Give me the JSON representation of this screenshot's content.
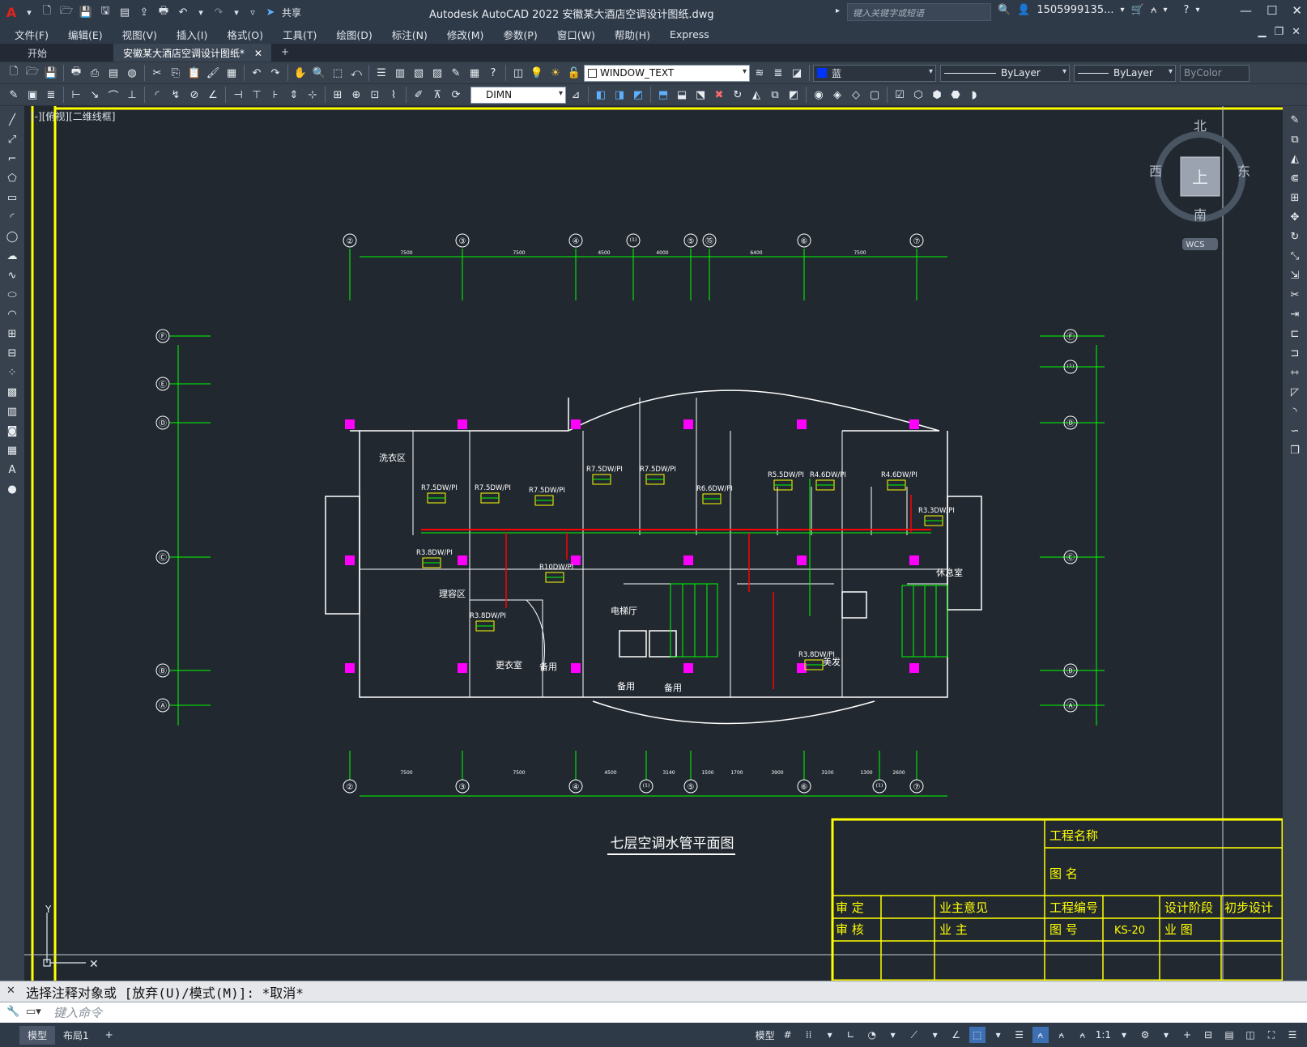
{
  "titlebar": {
    "app_title": "Autodesk AutoCAD 2022    安徽某大酒店空调设计图纸.dwg",
    "share_label": "共享",
    "search_placeholder": "键入关键字或短语",
    "user": "1505999135...",
    "menu_a": "A"
  },
  "menus": [
    "文件(F)",
    "编辑(E)",
    "视图(V)",
    "插入(I)",
    "格式(O)",
    "工具(T)",
    "绘图(D)",
    "标注(N)",
    "修改(M)",
    "参数(P)",
    "窗口(W)",
    "帮助(H)",
    "Express"
  ],
  "doc_tabs": {
    "start": "开始",
    "active": "安徽某大酒店空调设计图纸*",
    "add": "+"
  },
  "toolbar": {
    "layer_name": "WINDOW_TEXT",
    "color_name": "蓝",
    "linetype": "ByLayer",
    "lineweight": "ByLayer",
    "plotstyle": "ByColor",
    "dimstyle": "DIMN"
  },
  "viewport_label": "[-][俯视][二维线框]",
  "viewcube": {
    "north": "北",
    "south": "南",
    "east": "东",
    "west": "西",
    "face": "上",
    "wcs": "WCS"
  },
  "drawing": {
    "title": "七层空调水管平面图",
    "top_axes": [
      "②",
      "③",
      "④",
      "⁽¹⁾",
      "⑤",
      "⑮",
      "⑥",
      "⑦"
    ],
    "bottom_axes": [
      "②",
      "③",
      "④",
      "⁽¹⁾",
      "⑤",
      "⑥",
      "⁽¹⁾",
      "⑦"
    ],
    "left_axes": [
      "Ⓕ",
      "Ⓔ",
      "Ⓓ",
      "Ⓒ",
      "Ⓑ",
      "Ⓐ"
    ],
    "right_axes": [
      "Ⓕ",
      "⁽¹⁾",
      "Ⓓ",
      "Ⓒ",
      "Ⓑ",
      "Ⓐ"
    ],
    "top_dims": [
      "7500",
      "7500",
      "4500",
      "4000",
      "6400",
      "7500"
    ],
    "bottom_dims": [
      "7500",
      "7500",
      "4500",
      "3140",
      "1500",
      "1700",
      "3900",
      "3100",
      "1300",
      "2600"
    ],
    "rooms": [
      "洗衣区",
      "理容区",
      "更衣室",
      "备用",
      "电梯厅",
      "备用",
      "备用",
      "美发",
      "休息室"
    ],
    "units": [
      "R7.5DW/PI",
      "R7.5DW/PI",
      "R7.5DW/PI",
      "R7.5DW/PI",
      "R7.5DW/PI",
      "R6.6DW/PI",
      "R5.5DW/PI",
      "R4.6DW/PI",
      "R4.6DW/PI",
      "R3.8DW/PI",
      "R3.8DW/PI",
      "R3.8DW/PI",
      "R10DW/PI",
      "R3.3DW/PI"
    ]
  },
  "titleblock": {
    "project_name": "工程名称",
    "drawing_name": "图    名",
    "approve": "审    定",
    "owner_opinion": "业主意见",
    "project_no": "工程编号",
    "design_stage": "设计阶段",
    "stage_value": "初步设计",
    "review": "审    核",
    "owner": "业    主",
    "drawing_no": "图    号",
    "drawing_no_value": "KS-20",
    "owner2": "业    图"
  },
  "command": {
    "history": "选择注释对象或 [放弃(U)/模式(M)]: *取消*",
    "placeholder": "键入命令"
  },
  "status": {
    "model_tab": "模型",
    "layout_tab": "布局1",
    "model_label": "模型",
    "scale": "1:1"
  },
  "colors": {
    "accent": "#ffff00",
    "magenta": "#ff00ff",
    "green": "#00ff00",
    "red": "#ff0000",
    "cyan": "#00ffff"
  }
}
